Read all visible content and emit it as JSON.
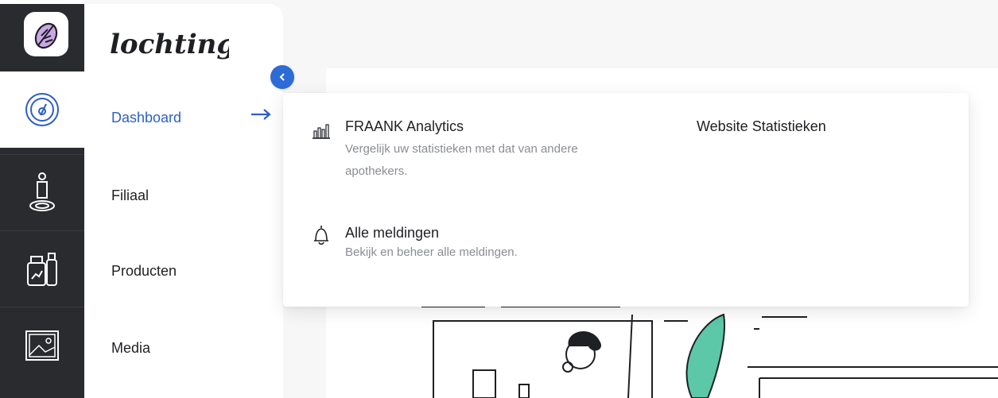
{
  "brand": {
    "wordmark": "lochting"
  },
  "sidebar": {
    "items": [
      {
        "label": "Dashboard",
        "icon": "gauge-icon",
        "active": true
      },
      {
        "label": "Filiaal",
        "icon": "store-person-icon",
        "active": false
      },
      {
        "label": "Producten",
        "icon": "products-icon",
        "active": false
      },
      {
        "label": "Media",
        "icon": "image-icon",
        "active": false
      }
    ]
  },
  "dropdown": {
    "entries": [
      {
        "title": "FRAANK Analytics",
        "description": "Vergelijk uw statistieken met dat van andere apothekers.",
        "icon": "analytics-chart-icon"
      },
      {
        "title": "Website Statistieken",
        "description": "",
        "icon": ""
      },
      {
        "title": "Alle meldingen",
        "description": "Bekijk en beheer alle meldingen.",
        "icon": "bell-icon"
      }
    ]
  },
  "colors": {
    "accent": "#2d5fc8",
    "rail": "#2a2b2f",
    "illustration_green": "#5cc8a8"
  }
}
